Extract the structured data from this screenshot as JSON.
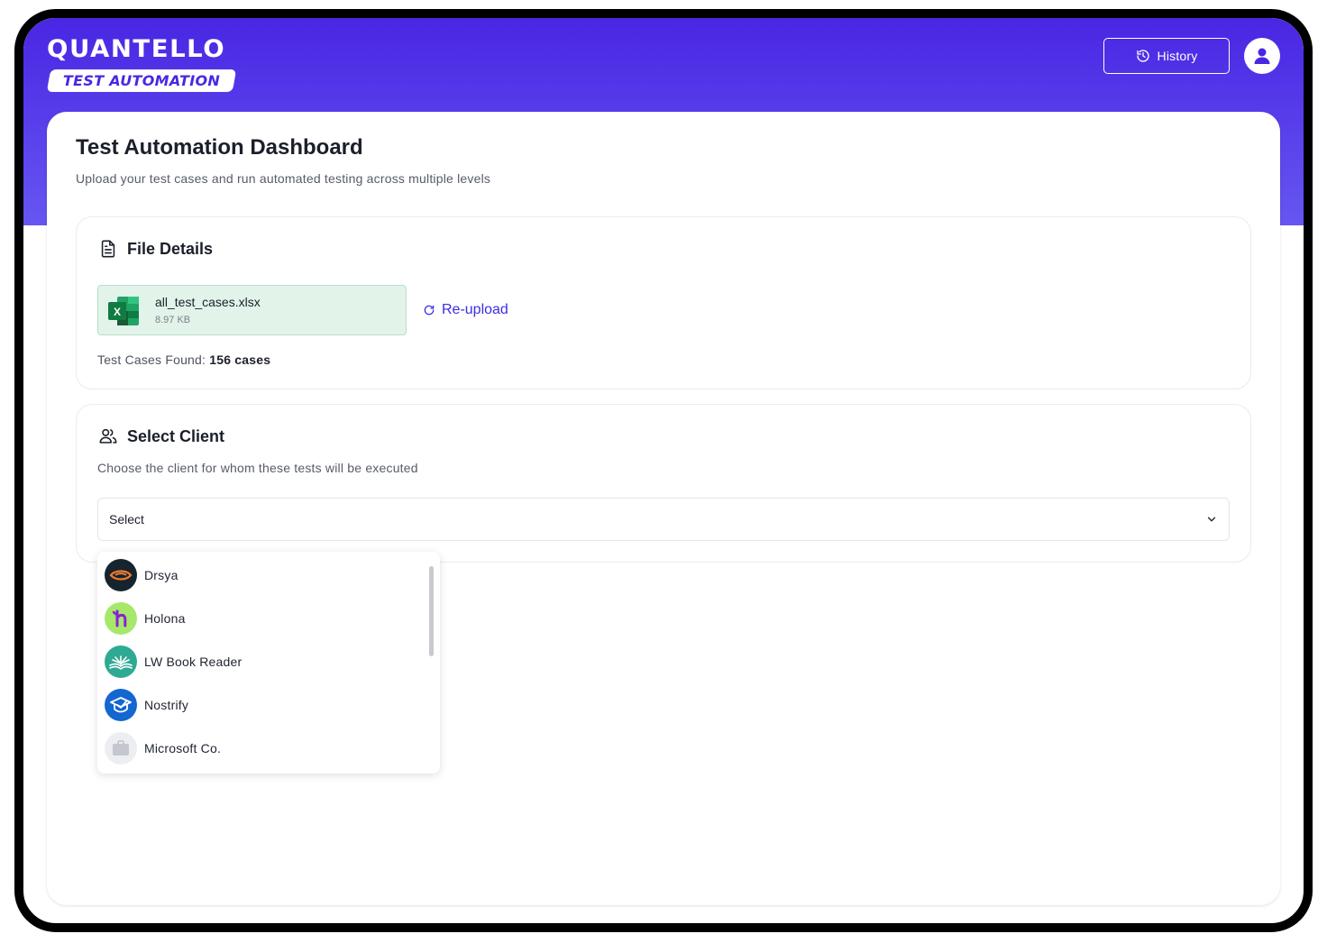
{
  "brand": {
    "name": "QUANTELLO",
    "tagline": "TEST AUTOMATION",
    "color": "#4a26e3"
  },
  "header": {
    "history_label": "History",
    "history_icon": "history-icon",
    "avatar_icon": "user-icon"
  },
  "page": {
    "title": "Test Automation Dashboard",
    "subtitle": "Upload your test cases and run automated testing across multiple levels"
  },
  "file_details": {
    "title": "File Details",
    "icon": "file-icon",
    "file_name": "all_test_cases.xlsx",
    "file_size": "8.97 KB",
    "file_icon": "excel-icon",
    "reupload_label": "Re-upload",
    "cases_label": "Test Cases Found:",
    "cases_value": "156 cases"
  },
  "client": {
    "title": "Select Client",
    "icon": "users-icon",
    "subtitle": "Choose the client for whom these tests will be executed",
    "select_value": "Select",
    "options": [
      {
        "label": "Drsya",
        "icon": "drsya-logo"
      },
      {
        "label": "Holona",
        "icon": "holona-logo"
      },
      {
        "label": "LW Book Reader",
        "icon": "lw-book-logo"
      },
      {
        "label": "Nostrify",
        "icon": "nostrify-logo"
      },
      {
        "label": "Microsoft Co.",
        "icon": "briefcase-icon"
      }
    ]
  },
  "colors": {
    "accent": "#3a2ee2",
    "file_chip_bg": "#e2f3ea"
  }
}
